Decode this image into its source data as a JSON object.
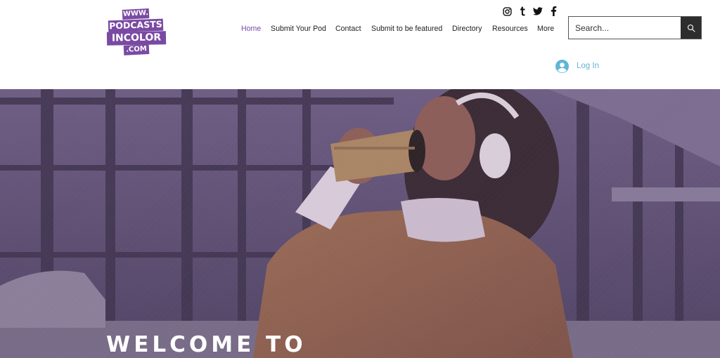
{
  "brand": {
    "logo_lines": [
      "WWW.",
      "PODCASTS",
      "INCOLOR",
      ".COM"
    ],
    "primary_color": "#7a4aa3"
  },
  "nav": {
    "items": [
      {
        "label": "Home",
        "active": true
      },
      {
        "label": "Submit Your Pod",
        "active": false
      },
      {
        "label": "Contact",
        "active": false
      },
      {
        "label": "Submit to be featured",
        "active": false
      },
      {
        "label": "Directory",
        "active": false
      },
      {
        "label": "Resources",
        "active": false
      },
      {
        "label": "More",
        "active": false
      }
    ]
  },
  "social": {
    "icons": [
      "instagram-icon",
      "tumblr-icon",
      "twitter-icon",
      "facebook-icon"
    ]
  },
  "search": {
    "placeholder": "Search...",
    "value": "",
    "icon": "search-icon"
  },
  "auth": {
    "login_label": "Log In",
    "login_color": "#5fb6d6",
    "icon": "user-avatar-icon"
  },
  "hero": {
    "title": "WELCOME TO",
    "overlay_color": "#5a4a6e"
  }
}
